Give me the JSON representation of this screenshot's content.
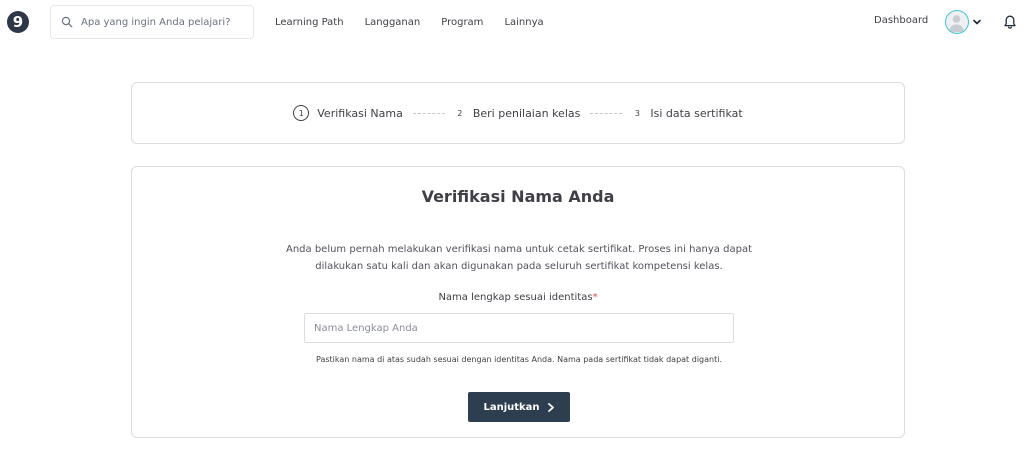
{
  "brand": {
    "logo_glyph": "9",
    "color": "#2d3748"
  },
  "search": {
    "placeholder": "Apa yang ingin Anda pelajari?",
    "value": ""
  },
  "nav": {
    "items": [
      {
        "label": "Learning Path"
      },
      {
        "label": "Langganan"
      },
      {
        "label": "Program"
      },
      {
        "label": "Lainnya"
      }
    ],
    "dashboard_label": "Dashboard",
    "avatar_ring_color": "#3ec6d6"
  },
  "stepper": {
    "steps": [
      {
        "number": "1",
        "label": "Verifikasi Nama",
        "active": true
      },
      {
        "number": "2",
        "label": "Beri penilaian kelas",
        "active": false
      },
      {
        "number": "3",
        "label": "Isi data sertifikat",
        "active": false
      }
    ]
  },
  "verification": {
    "title": "Verifikasi Nama Anda",
    "description": "Anda belum pernah melakukan verifikasi nama untuk cetak sertifikat. Proses ini hanya dapat dilakukan satu kali dan akan digunakan pada seluruh sertifikat kompetensi kelas.",
    "field_label": "Nama lengkap sesuai identitas",
    "required_mark": "*",
    "input_placeholder": "Nama Lengkap Anda",
    "input_value": "",
    "hint": "Pastikan nama di atas sudah sesuai dengan identitas Anda. Nama pada sertifikat tidak dapat diganti.",
    "submit_label": "Lanjutkan",
    "button_color": "#2d3e50"
  },
  "icons": {
    "search": "search-icon",
    "avatar": "user-avatar-icon",
    "chevron": "chevron-down-icon",
    "bell": "bell-icon",
    "arrow": "chevron-right-icon"
  }
}
